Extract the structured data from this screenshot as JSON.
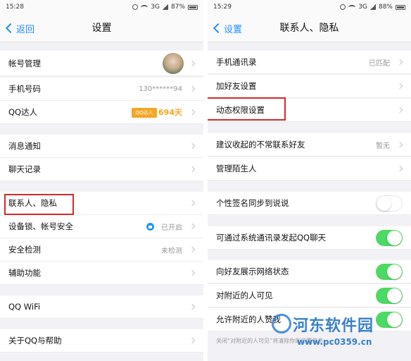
{
  "left": {
    "status": {
      "time": "15:28",
      "signal": "3G",
      "battery": "87%"
    },
    "nav": {
      "back": "返回",
      "title": "设置"
    },
    "items": [
      {
        "label": "帐号管理"
      },
      {
        "label": "手机号码",
        "value": "130******94"
      },
      {
        "label": "QQ达人",
        "badge": "QQ达人",
        "value": "694天"
      },
      {
        "label": "消息通知"
      },
      {
        "label": "聊天记录"
      },
      {
        "label": "联系人、隐私"
      },
      {
        "label": "设备锁、帐号安全",
        "value": "已开启"
      },
      {
        "label": "安全检测",
        "value": "未检测"
      },
      {
        "label": "辅助功能"
      },
      {
        "label": "QQ WiFi"
      },
      {
        "label": "关于QQ与帮助"
      }
    ]
  },
  "right": {
    "status": {
      "time": "15:29",
      "signal": "3G",
      "battery": "88%"
    },
    "nav": {
      "back": "设置",
      "title": "联系人、隐私"
    },
    "items": [
      {
        "label": "手机通讯录",
        "value": "已匹配"
      },
      {
        "label": "加好友设置"
      },
      {
        "label": "动态权限设置"
      },
      {
        "label": "建议收起的不常联系好友",
        "value": "暂无"
      },
      {
        "label": "管理陌生人"
      },
      {
        "label": "个性签名同步到说说",
        "toggle": "off"
      },
      {
        "label": "可通过系统通讯录发起QQ聊天",
        "toggle": "on"
      },
      {
        "label": "向好友展示网络状态",
        "toggle": "on"
      },
      {
        "label": "对附近的人可见",
        "toggle": "on"
      },
      {
        "label": "允许附近的人赞我",
        "toggle": "on"
      }
    ],
    "footnote": "关闭“对附近的人可见”将清除你的位置信息"
  },
  "watermark": {
    "text": "河东软件园",
    "url": "www.pc0359.cn"
  },
  "colors": {
    "accent": "#1e90ff",
    "toggle_on": "#4cd964",
    "highlight": "#d62828",
    "qq_gold": "#f5a623"
  }
}
